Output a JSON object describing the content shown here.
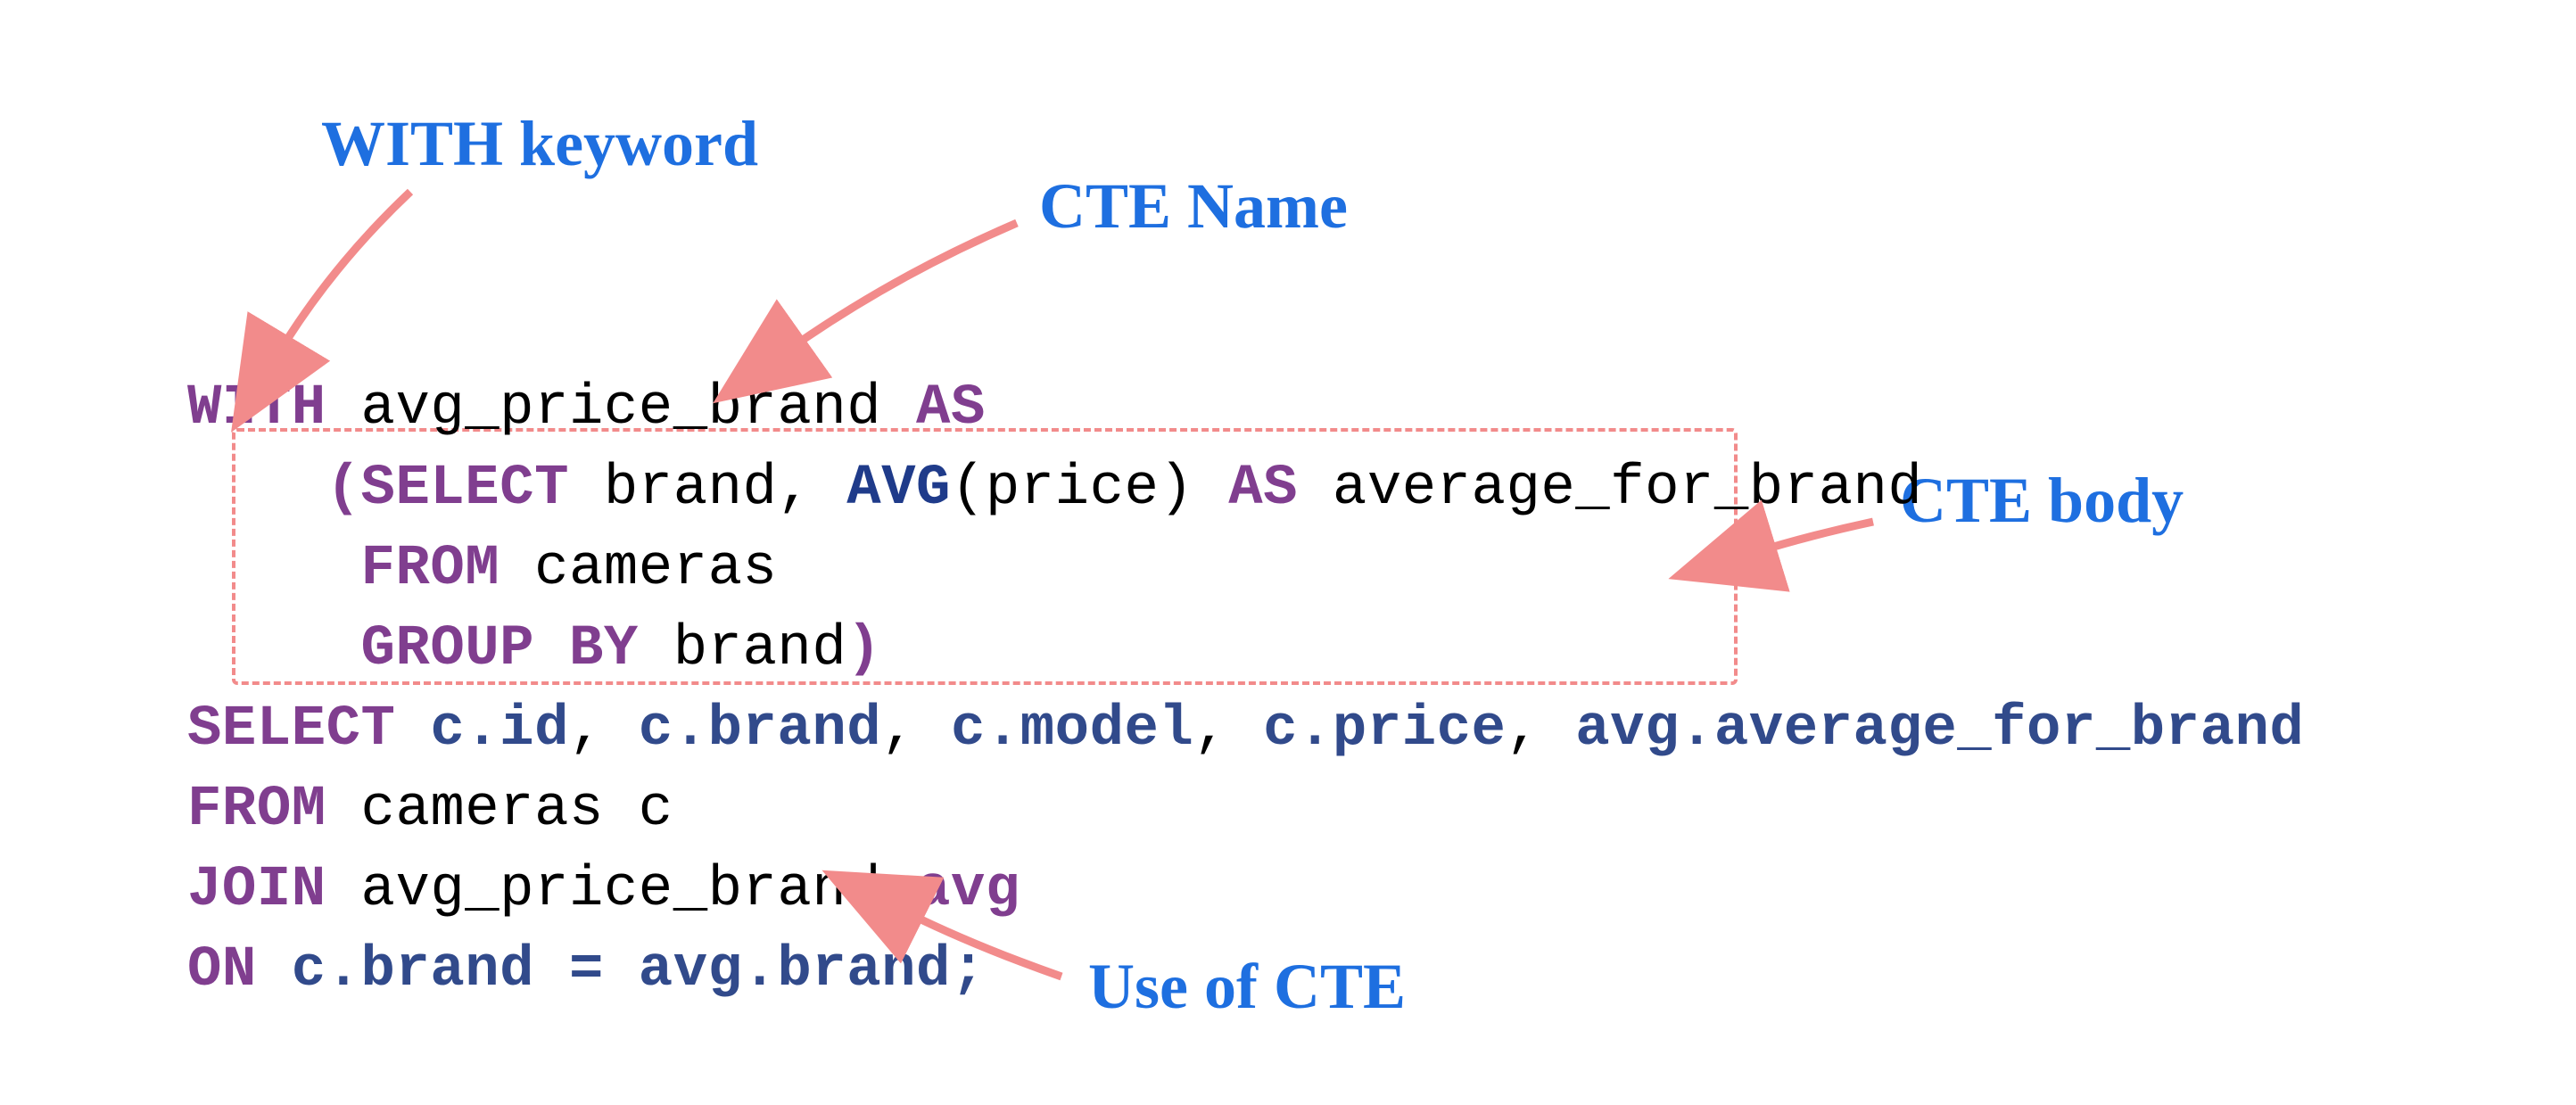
{
  "annotations": {
    "with_keyword": "WITH keyword",
    "cte_name": "CTE Name",
    "cte_body": "CTE body",
    "use_of_cte": "Use of CTE"
  },
  "code": {
    "l1": {
      "with": "WITH ",
      "name": "avg_price_brand ",
      "as": "AS"
    },
    "l2": {
      "indent": "    ",
      "lparen": "(",
      "select": "SELECT ",
      "cols1": "brand, ",
      "avg": "AVG",
      "avgarg": "(price) ",
      "as": "AS ",
      "alias": "average_for_brand"
    },
    "l3": {
      "indent": "     ",
      "from": "FROM ",
      "tbl": "cameras"
    },
    "l4": {
      "indent": "     ",
      "group": "GROUP BY ",
      "col": "brand",
      "rparen": ")"
    },
    "l5": {
      "select": "SELECT ",
      "c1": "c",
      "d1": ".",
      "f1": "id",
      "s1": ", ",
      "c2": "c",
      "d2": ".",
      "f2": "brand",
      "s2": ", ",
      "c3": "c",
      "d3": ".",
      "f3": "model",
      "s3": ", ",
      "c4": "c",
      "d4": ".",
      "f4": "price",
      "s4": ", ",
      "c5": "avg",
      "d5": ".",
      "f5": "average_for_brand"
    },
    "l6": {
      "from": "FROM ",
      "tbl": "cameras c"
    },
    "l7": {
      "join": "JOIN ",
      "tbl": "avg_price_brand ",
      "alias": "avg"
    },
    "l8": {
      "on": "ON ",
      "l1": "c",
      "d1": ".",
      "f1": "brand",
      "eq": " = ",
      "l2": "avg",
      "d2": ".",
      "f2": "brand",
      "semi": ";"
    }
  },
  "colors": {
    "keyword": "#803e8f",
    "ref": "#314a8b",
    "arrow": "#f28b8b",
    "annotation": "#1e6fe0",
    "dashed_border": "#f28b8b"
  }
}
